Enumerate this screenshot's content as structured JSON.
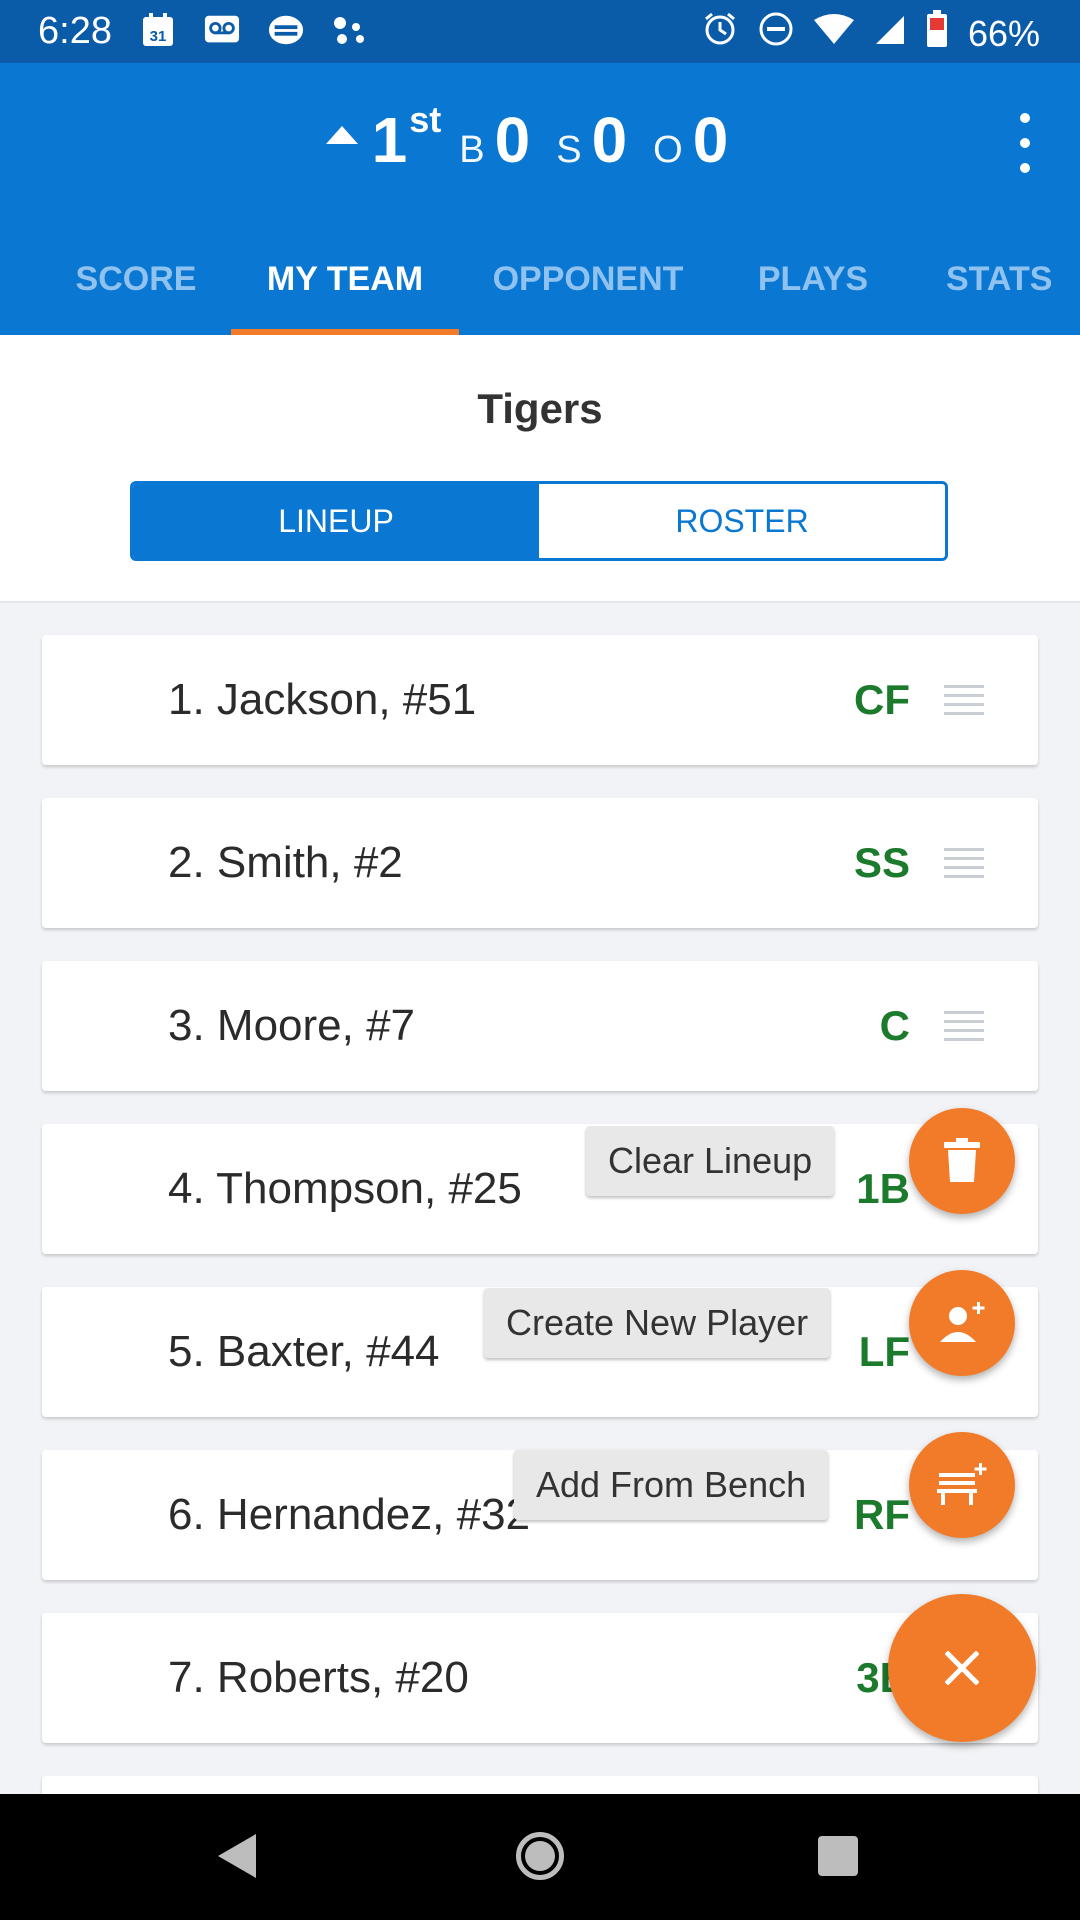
{
  "status_bar": {
    "time": "6:28",
    "left_icons": [
      "calendar-icon",
      "voicemail-icon",
      "messenger-icon",
      "assistant-dots-icon"
    ],
    "right_icons": [
      "alarm-icon",
      "do-not-disturb-icon",
      "wifi-icon",
      "signal-icon",
      "battery-icon"
    ],
    "battery": "66%"
  },
  "app_bar": {
    "inning_number": "1",
    "inning_suffix": "st",
    "balls_label": "B",
    "balls": "0",
    "strikes_label": "S",
    "strikes": "0",
    "outs_label": "O",
    "outs": "0",
    "accent_color": "#0a78d2"
  },
  "tabs": [
    {
      "label": "SCORE",
      "active": false
    },
    {
      "label": "MY TEAM",
      "active": true
    },
    {
      "label": "OPPONENT",
      "active": false
    },
    {
      "label": "PLAYS",
      "active": false
    },
    {
      "label": "STATS",
      "active": false
    }
  ],
  "team": {
    "name": "Tigers",
    "segments": [
      {
        "label": "LINEUP",
        "active": true
      },
      {
        "label": "ROSTER",
        "active": false
      }
    ]
  },
  "lineup": [
    {
      "name": "1. Jackson, #51",
      "position": "CF"
    },
    {
      "name": "2. Smith, #2",
      "position": "SS"
    },
    {
      "name": "3. Moore, #7",
      "position": "C"
    },
    {
      "name": "4. Thompson, #25",
      "position": "1B"
    },
    {
      "name": "5. Baxter, #44",
      "position": "LF"
    },
    {
      "name": "6. Hernandez, #32",
      "position": "RF"
    },
    {
      "name": "7. Roberts, #20",
      "position": "3B"
    }
  ],
  "fab_menu": {
    "clear_label": "Clear Lineup",
    "create_label": "Create New Player",
    "bench_label": "Add From Bench",
    "fab_color": "#f27b2a"
  }
}
